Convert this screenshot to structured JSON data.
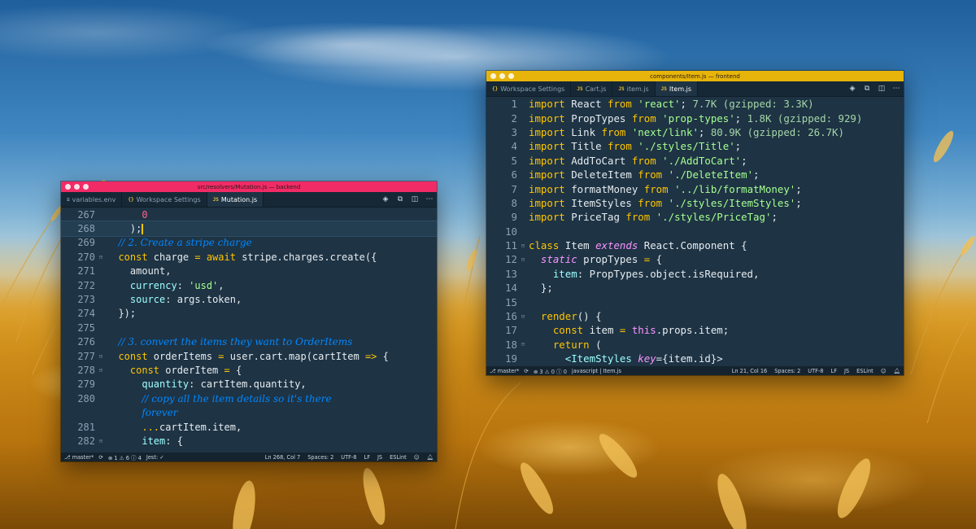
{
  "colors": {
    "backend_titlebar": "#f02b66",
    "frontend_titlebar": "#e6b40a",
    "editor_bg": "#1e3344",
    "keyword": "#ffc600",
    "string": "#a5ff90",
    "comment": "#0088ff",
    "number": "#ff628c",
    "property": "#9effff"
  },
  "backend": {
    "title": "src/resolvers/Mutation.js — backend",
    "tabs": [
      {
        "icon": "env-file-icon",
        "label": "variables.env",
        "active": false
      },
      {
        "icon": "json-file-icon",
        "label": "Workspace Settings",
        "active": false
      },
      {
        "icon": "js-file-icon",
        "label": "Mutation.js",
        "active": true
      }
    ],
    "lines": [
      "267",
      "268",
      "269",
      "270",
      "271",
      "272",
      "273",
      "274",
      "275",
      "276",
      "277",
      "278",
      "279",
      "280",
      "",
      "281",
      "282"
    ],
    "status": {
      "branch": "master*",
      "problems": "⊗ 1 ⚠ 6 ⓘ 4",
      "jest": "Jest: ✓",
      "position": "Ln 268, Col 7",
      "spaces": "Spaces: 2",
      "encoding": "UTF-8",
      "eol": "LF",
      "language": "JS",
      "linter": "ESLint"
    }
  },
  "frontend": {
    "title": "components/Item.js — frontend",
    "tabs": [
      {
        "icon": "json-file-icon",
        "label": "Workspace Settings",
        "active": false
      },
      {
        "icon": "js-file-icon",
        "label": "Cart.js",
        "active": false
      },
      {
        "icon": "js-file-icon",
        "label": "item.js",
        "active": false
      },
      {
        "icon": "js-file-icon",
        "label": "Item.js",
        "active": true
      }
    ],
    "lines": [
      "1",
      "2",
      "3",
      "4",
      "5",
      "6",
      "7",
      "8",
      "9",
      "10",
      "11",
      "12",
      "13",
      "14",
      "15",
      "16",
      "17",
      "18",
      "19"
    ],
    "status": {
      "branch": "master*",
      "problems": "⊗ 3 ⚠ 0 ⓘ 0",
      "file": "javascript | Item.js",
      "position": "Ln 21, Col 16",
      "spaces": "Spaces: 2",
      "encoding": "UTF-8",
      "eol": "LF",
      "language": "JS",
      "linter": "ESLint"
    }
  },
  "code": {
    "b267_num": "0",
    "b268": ");",
    "b269_cmt": "// 2. Create a stripe charge",
    "b270_kw1": "const",
    "b270_a": " charge ",
    "b270_eq": "=",
    "b270_kw2": " await",
    "b270_b": " stripe.charges.",
    "b270_fn": "create",
    "b270_c": "({",
    "b271": "amount,",
    "b272_prop": "currency",
    "b272_a": ": ",
    "b272_str": "'usd'",
    "b272_b": ",",
    "b273_prop": "source",
    "b273_a": ": args.token,",
    "b274": "});",
    "b276_cmt": "// 3. convert the items they want to OrderItems",
    "b277_kw": "const",
    "b277_a": " orderItems ",
    "b277_eq": "=",
    "b277_b": " user.cart.",
    "b277_fn": "map",
    "b277_c": "(cartItem ",
    "b277_arrow": "=>",
    "b277_d": " {",
    "b278_kw": "const",
    "b278_a": " orderItem ",
    "b278_eq": "=",
    "b278_b": " {",
    "b279_prop": "quantity",
    "b279_a": ": cartItem.quantity,",
    "b280_cmt": "// copy all the item details so it's there",
    "b280b_cmt": "forever",
    "b281_kw": "...",
    "b281_a": "cartItem.item,",
    "b282_prop": "item",
    "b282_a": ": {",
    "imp": "import",
    "from": "from",
    "f1_a": " React ",
    "f1_str": "'react'",
    "f1_b": ";",
    "f1_size": " 7.7K (gzipped: 3.3K)",
    "f2_a": " PropTypes ",
    "f2_str": "'prop-types'",
    "f2_b": ";",
    "f2_size": " 1.8K (gzipped: 929)",
    "f3_a": " Link ",
    "f3_str": "'next/link'",
    "f3_b": ";",
    "f3_size": " 80.9K (gzipped: 26.7K)",
    "f4_a": " Title ",
    "f4_str": "'./styles/Title'",
    "f5_a": " AddToCart ",
    "f5_str": "'./AddToCart'",
    "f6_a": " DeleteItem ",
    "f6_str": "'./DeleteItem'",
    "f7_a": " formatMoney ",
    "f7_str": "'../lib/formatMoney'",
    "f8_a": " ItemStyles ",
    "f8_str": "'./styles/ItemStyles'",
    "f9_a": " PriceTag ",
    "f9_str": "'./styles/PriceTag'",
    "semi": ";",
    "f11_kw": "class",
    "f11_a": " Item ",
    "f11_ext": "extends",
    "f11_b": " React.Component {",
    "f12_kw": "static",
    "f12_a": " propTypes ",
    "f12_eq": "=",
    "f12_b": " {",
    "f13_prop": "item",
    "f13_a": ": PropTypes.object.isRequired,",
    "f14": "};",
    "f16_fn": "render",
    "f16_a": "() {",
    "f17_kw": "const",
    "f17_a": " item ",
    "f17_eq": "=",
    "f17_this": " this",
    "f17_b": ".props.item;",
    "f18_kw": "return",
    "f18_a": " (",
    "f19_tag": "<ItemStyles",
    "f19_attr": " key",
    "f19_a": "={item.id}>"
  }
}
